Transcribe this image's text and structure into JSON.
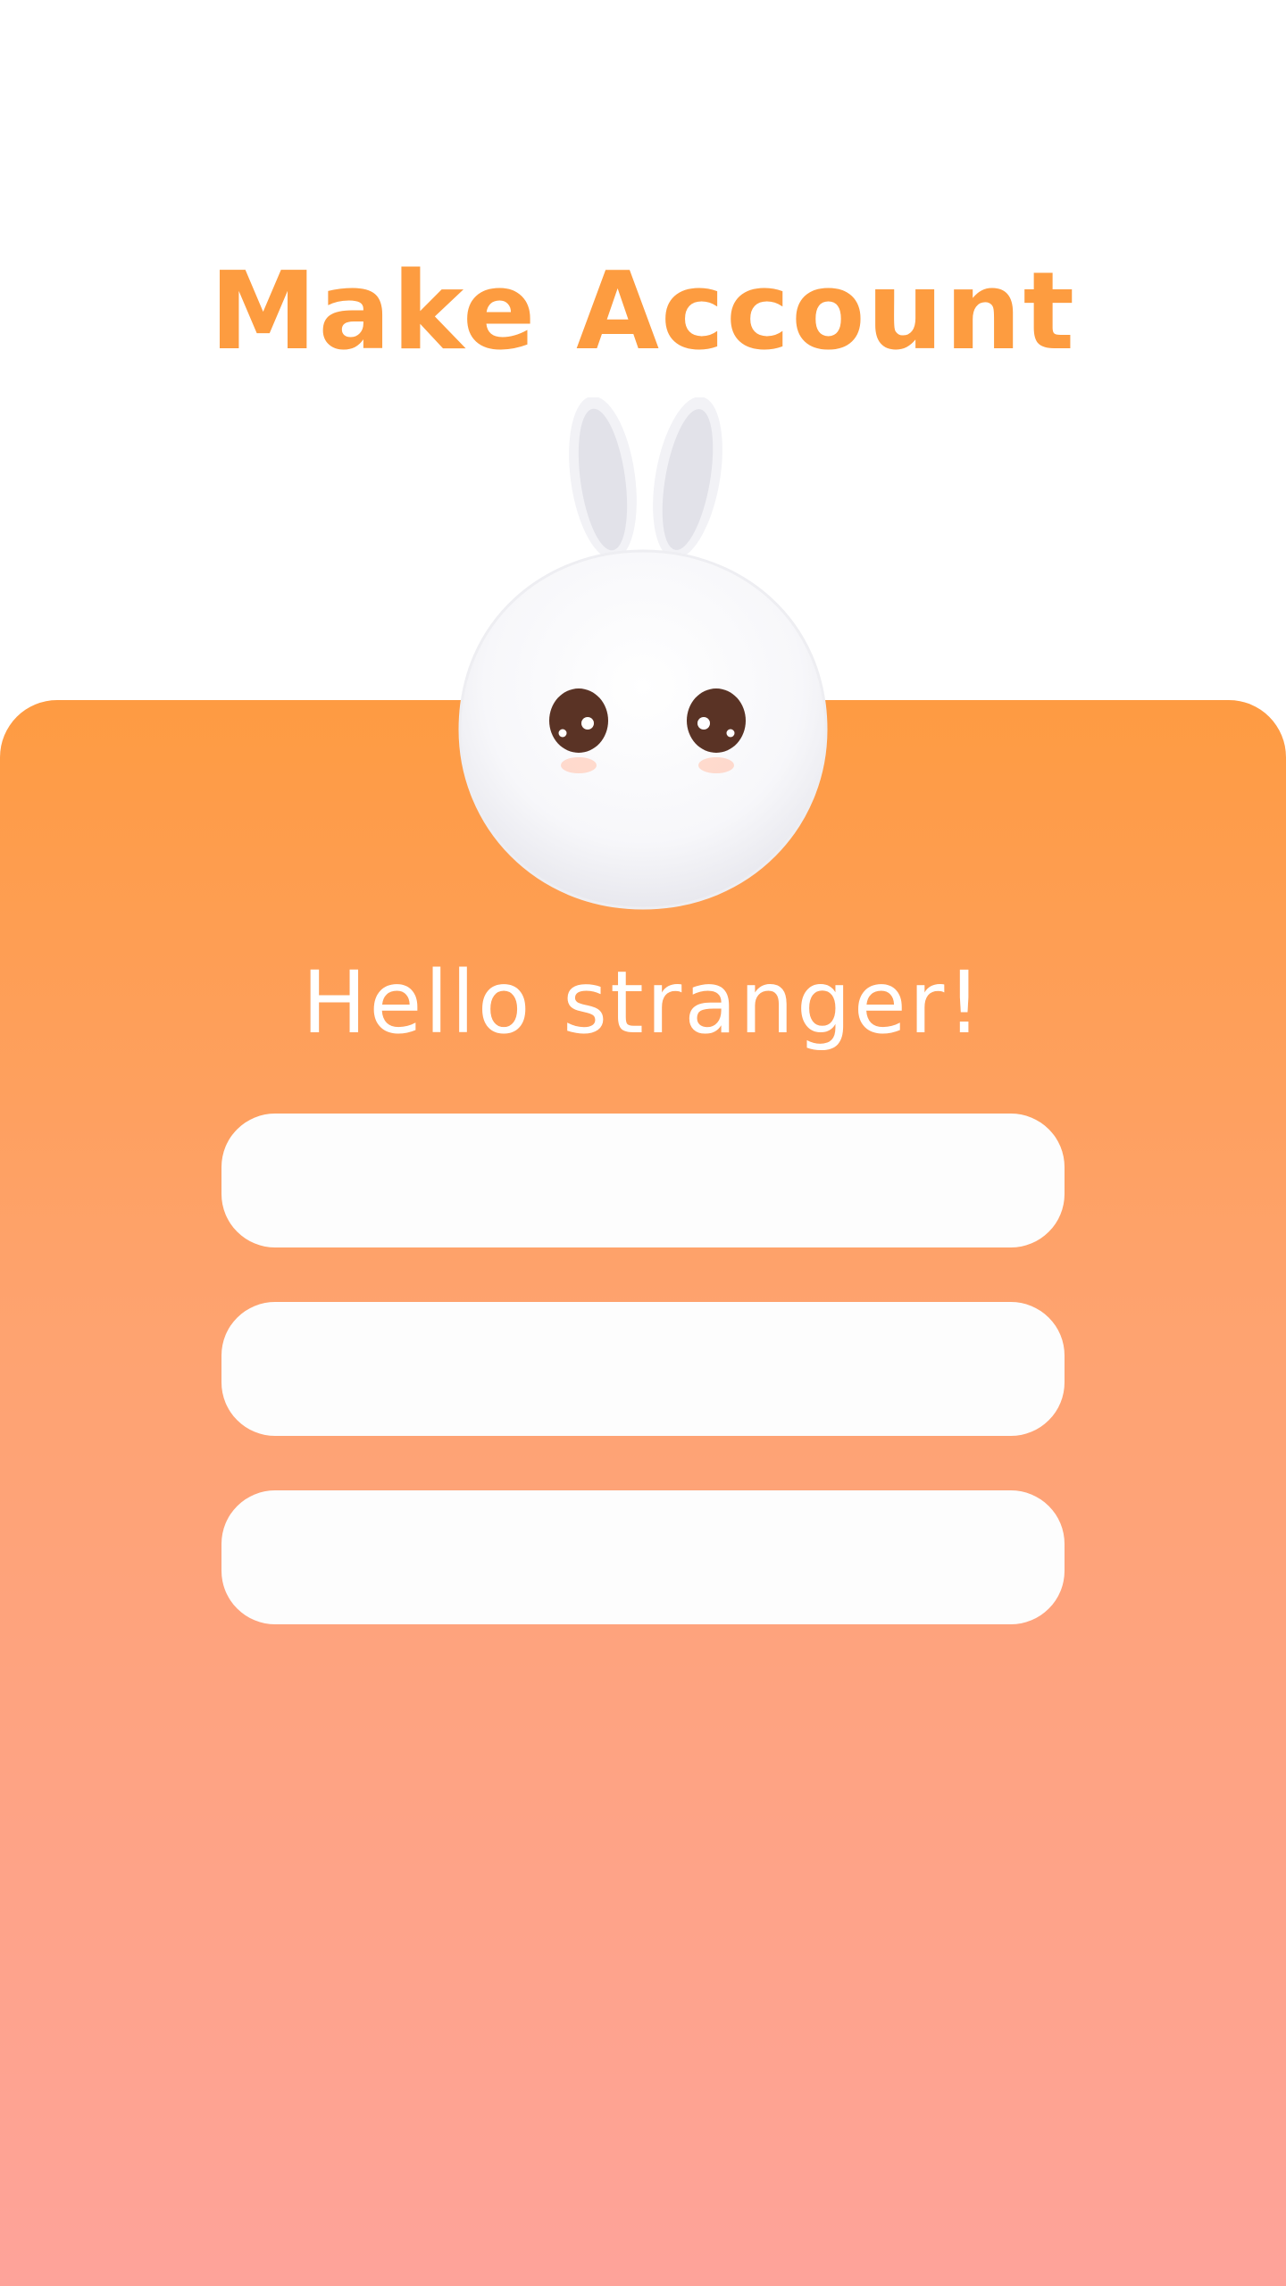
{
  "header": {
    "title": "Make Account"
  },
  "mascot": {
    "icon": "bunny-mascot-icon"
  },
  "form": {
    "greeting": "Hello stranger!",
    "fields": [
      {
        "value": "",
        "placeholder": ""
      },
      {
        "value": "",
        "placeholder": ""
      },
      {
        "value": "",
        "placeholder": ""
      }
    ]
  },
  "colors": {
    "accent": "#fd9c40",
    "gradient_top": "#fe9b42",
    "gradient_bottom": "#fea39a",
    "field_background": "#fdfdfd"
  }
}
